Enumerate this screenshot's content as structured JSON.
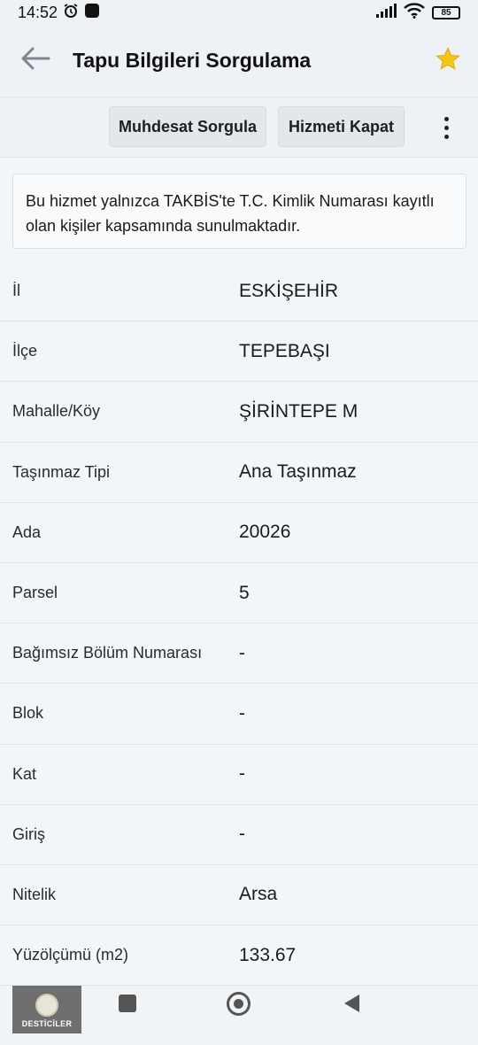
{
  "status_bar": {
    "time": "14:52",
    "battery": "85"
  },
  "app_bar": {
    "title": "Tapu Bilgileri Sorgulama",
    "icons": [
      "back-arrow-icon",
      "star-icon"
    ],
    "star_color": "#f5c518"
  },
  "toolbar": {
    "buttons": [
      {
        "label": "Muhdesat Sorgula"
      },
      {
        "label": "Hizmeti Kapat"
      }
    ],
    "more_icon": "more-vert-icon"
  },
  "notice": {
    "text": "Bu hizmet yalnızca TAKBİS'te T.C. Kimlik Numarası kayıtlı olan kişiler kapsamında sunulmaktadır."
  },
  "details": [
    {
      "label": "İl",
      "value": "ESKİŞEHİR"
    },
    {
      "label": "İlçe",
      "value": "TEPEBAŞI"
    },
    {
      "label": "Mahalle/Köy",
      "value": "ŞİRİNTEPE M"
    },
    {
      "label": "Taşınmaz Tipi",
      "value": "Ana Taşınmaz"
    },
    {
      "label": "Ada",
      "value": "20026"
    },
    {
      "label": "Parsel",
      "value": "5"
    },
    {
      "label": "Bağımsız Bölüm Numarası",
      "value": "-"
    },
    {
      "label": "Blok",
      "value": "-"
    },
    {
      "label": "Kat",
      "value": "-"
    },
    {
      "label": "Giriş",
      "value": "-"
    },
    {
      "label": "Nitelik",
      "value": "Arsa"
    },
    {
      "label": "Yüzölçümü (m2)",
      "value": "133.67"
    }
  ],
  "nav_bar": {
    "logo_text": "DESTİCİLER",
    "icons": [
      "recent-apps-icon",
      "home-icon",
      "back-triangle-icon"
    ]
  }
}
